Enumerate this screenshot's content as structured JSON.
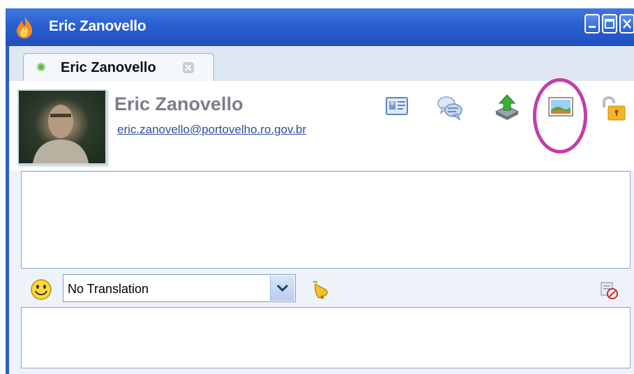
{
  "window": {
    "title": "Eric Zanovello",
    "controls": {
      "minimize": "minimize-icon",
      "maximize": "maximize-icon",
      "close": "close-icon"
    }
  },
  "tab": {
    "label": "Eric Zanovello",
    "status_color": "#59b84b"
  },
  "contact": {
    "name": "Eric Zanovello",
    "email": "eric.zanovello@portovelho.ro.gov.br"
  },
  "actions": [
    "contact-card-icon",
    "chat-history-icon",
    "send-file-icon",
    "send-image-icon",
    "lock-icon"
  ],
  "toolbar": {
    "translation_selected": "No Translation"
  },
  "colors": {
    "titlebar": "#2a5fd0",
    "highlight": "#c43dae",
    "link": "#2a4f9f",
    "name": "#7a7f87"
  }
}
